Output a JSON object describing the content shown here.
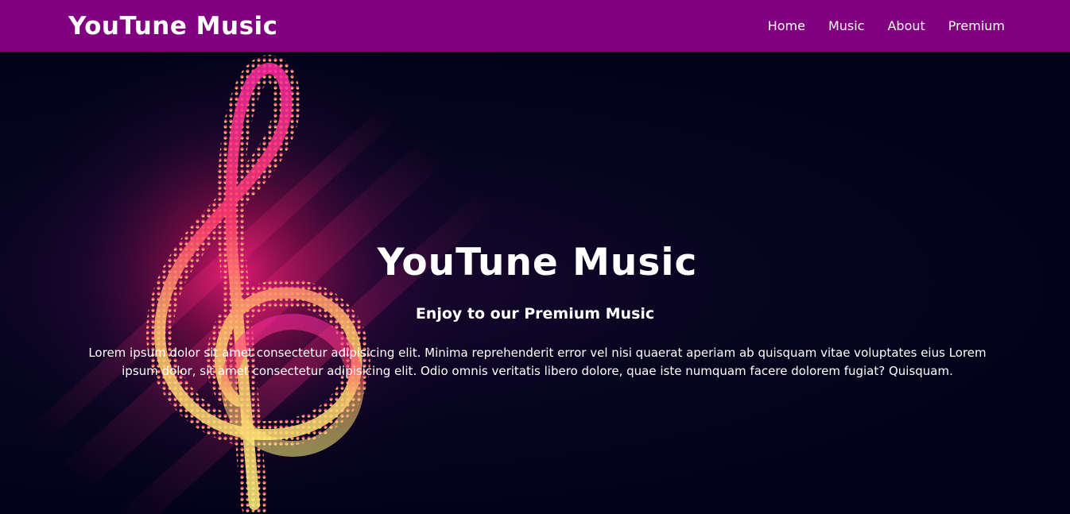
{
  "navbar": {
    "brand": "YouTune Music",
    "links": [
      "Home",
      "Music",
      "About",
      "Premium"
    ]
  },
  "hero": {
    "title": "YouTune Music",
    "subtitle": "Enjoy to our Premium Music",
    "text": "Lorem ipsum dolor sit amet consectetur adipisicing elit. Minima reprehenderit error vel nisi quaerat aperiam ab quisquam vitae voluptates eius Lorem ipsum dolor, sit amet consectetur adipisicing elit. Odio omnis veritatis libero dolore, quae iste numquam facere dolorem fugiat? Quisquam.",
    "background_icon": "treble-clef-icon"
  },
  "colors": {
    "navbar": "#800080",
    "hero_bg": "#02021a",
    "clef_pink": "#ff1a8c",
    "clef_yellow": "#fff27a"
  }
}
